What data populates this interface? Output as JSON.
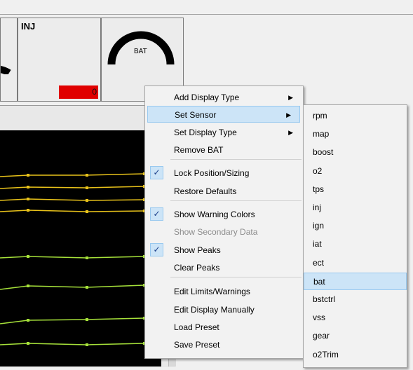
{
  "gauges": [
    {
      "label": "INJ",
      "value": "0"
    },
    {
      "label": "BAT"
    }
  ],
  "context_menu": {
    "items": [
      {
        "label": "Add Display Type",
        "submenu": true
      },
      {
        "label": "Set Sensor",
        "submenu": true,
        "highlighted": true
      },
      {
        "label": "Set Display Type",
        "submenu": true
      },
      {
        "label": "Remove BAT"
      },
      {
        "label": "Lock Position/Sizing",
        "checked": true
      },
      {
        "label": "Restore Defaults"
      },
      {
        "label": "Show Warning Colors",
        "checked": true
      },
      {
        "label": "Show Secondary Data",
        "disabled": true
      },
      {
        "label": "Show Peaks",
        "checked": true
      },
      {
        "label": "Clear Peaks"
      },
      {
        "label": "Edit Limits/Warnings"
      },
      {
        "label": "Edit Display Manually"
      },
      {
        "label": "Load Preset"
      },
      {
        "label": "Save Preset"
      }
    ]
  },
  "sensor_submenu": {
    "items": [
      "rpm",
      "map",
      "boost",
      "o2",
      "tps",
      "inj",
      "ign",
      "iat",
      "ect",
      "bat",
      "bstctrl",
      "vss",
      "gear",
      "o2Trim"
    ],
    "selected": "bat"
  },
  "colors": {
    "highlight": "#cce4f7",
    "highlight_border": "#99c9ef",
    "chart_bg": "#000000",
    "line_yellow": "#e8c21a",
    "line_green": "#a6e13a",
    "warning_red": "#e00000"
  }
}
